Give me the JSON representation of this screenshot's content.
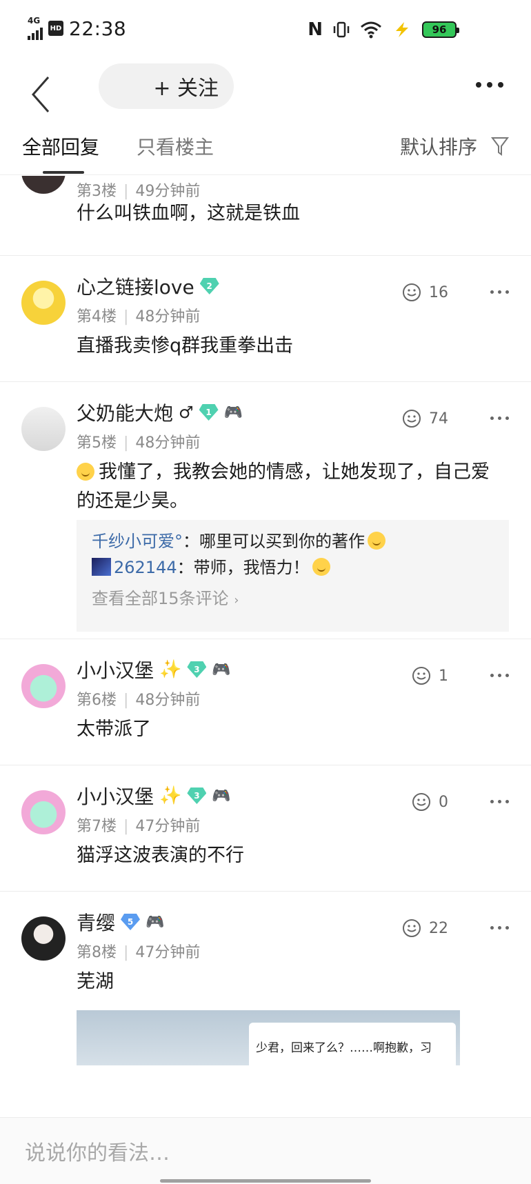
{
  "status_bar": {
    "network": "4G",
    "hd": "HD",
    "time": "22:38",
    "nfc": "N",
    "battery": "96"
  },
  "nav": {
    "follow_label": "+ 关注"
  },
  "tabs": {
    "all": "全部回复",
    "host_only": "只看楼主",
    "sort": "默认排序"
  },
  "posts": [
    {
      "floor": "第3楼",
      "time": "49分钟前",
      "content": "什么叫铁血啊，这就是铁血"
    },
    {
      "user": "心之链接love",
      "level": "2",
      "floor": "第4楼",
      "time": "48分钟前",
      "likes": "16",
      "content": "直播我卖惨q群我重拳出击"
    },
    {
      "user": "父奶能大炮",
      "gender": "♂",
      "level": "1",
      "floor": "第5楼",
      "time": "48分钟前",
      "likes": "74",
      "content": "我懂了，我教会她的情感，让她发现了，自己爱的还是少昊。",
      "replies": [
        {
          "name": "千纱小可爱°",
          "text": "：哪里可以买到你的著作"
        },
        {
          "name": "262144",
          "text": "：带师，我悟力！"
        }
      ],
      "view_all": "查看全部15条评论"
    },
    {
      "user": "小小汉堡",
      "level": "3",
      "floor": "第6楼",
      "time": "48分钟前",
      "likes": "1",
      "content": "太带派了"
    },
    {
      "user": "小小汉堡",
      "level": "3",
      "floor": "第7楼",
      "time": "47分钟前",
      "likes": "0",
      "content": "猫浮这波表演的不行"
    },
    {
      "user": "青缨",
      "level": "5",
      "floor": "第8楼",
      "time": "47分钟前",
      "likes": "22",
      "content": "芜湖",
      "image_caption": "少君，回来了么？……啊抱歉，习"
    }
  ],
  "input": {
    "placeholder": "说说你的看法…"
  },
  "colors": {
    "reply_name": "#3c6aa8",
    "badge_green": "#4fd1b0",
    "badge_blue": "#5a9cf0",
    "battery": "#34c759"
  }
}
